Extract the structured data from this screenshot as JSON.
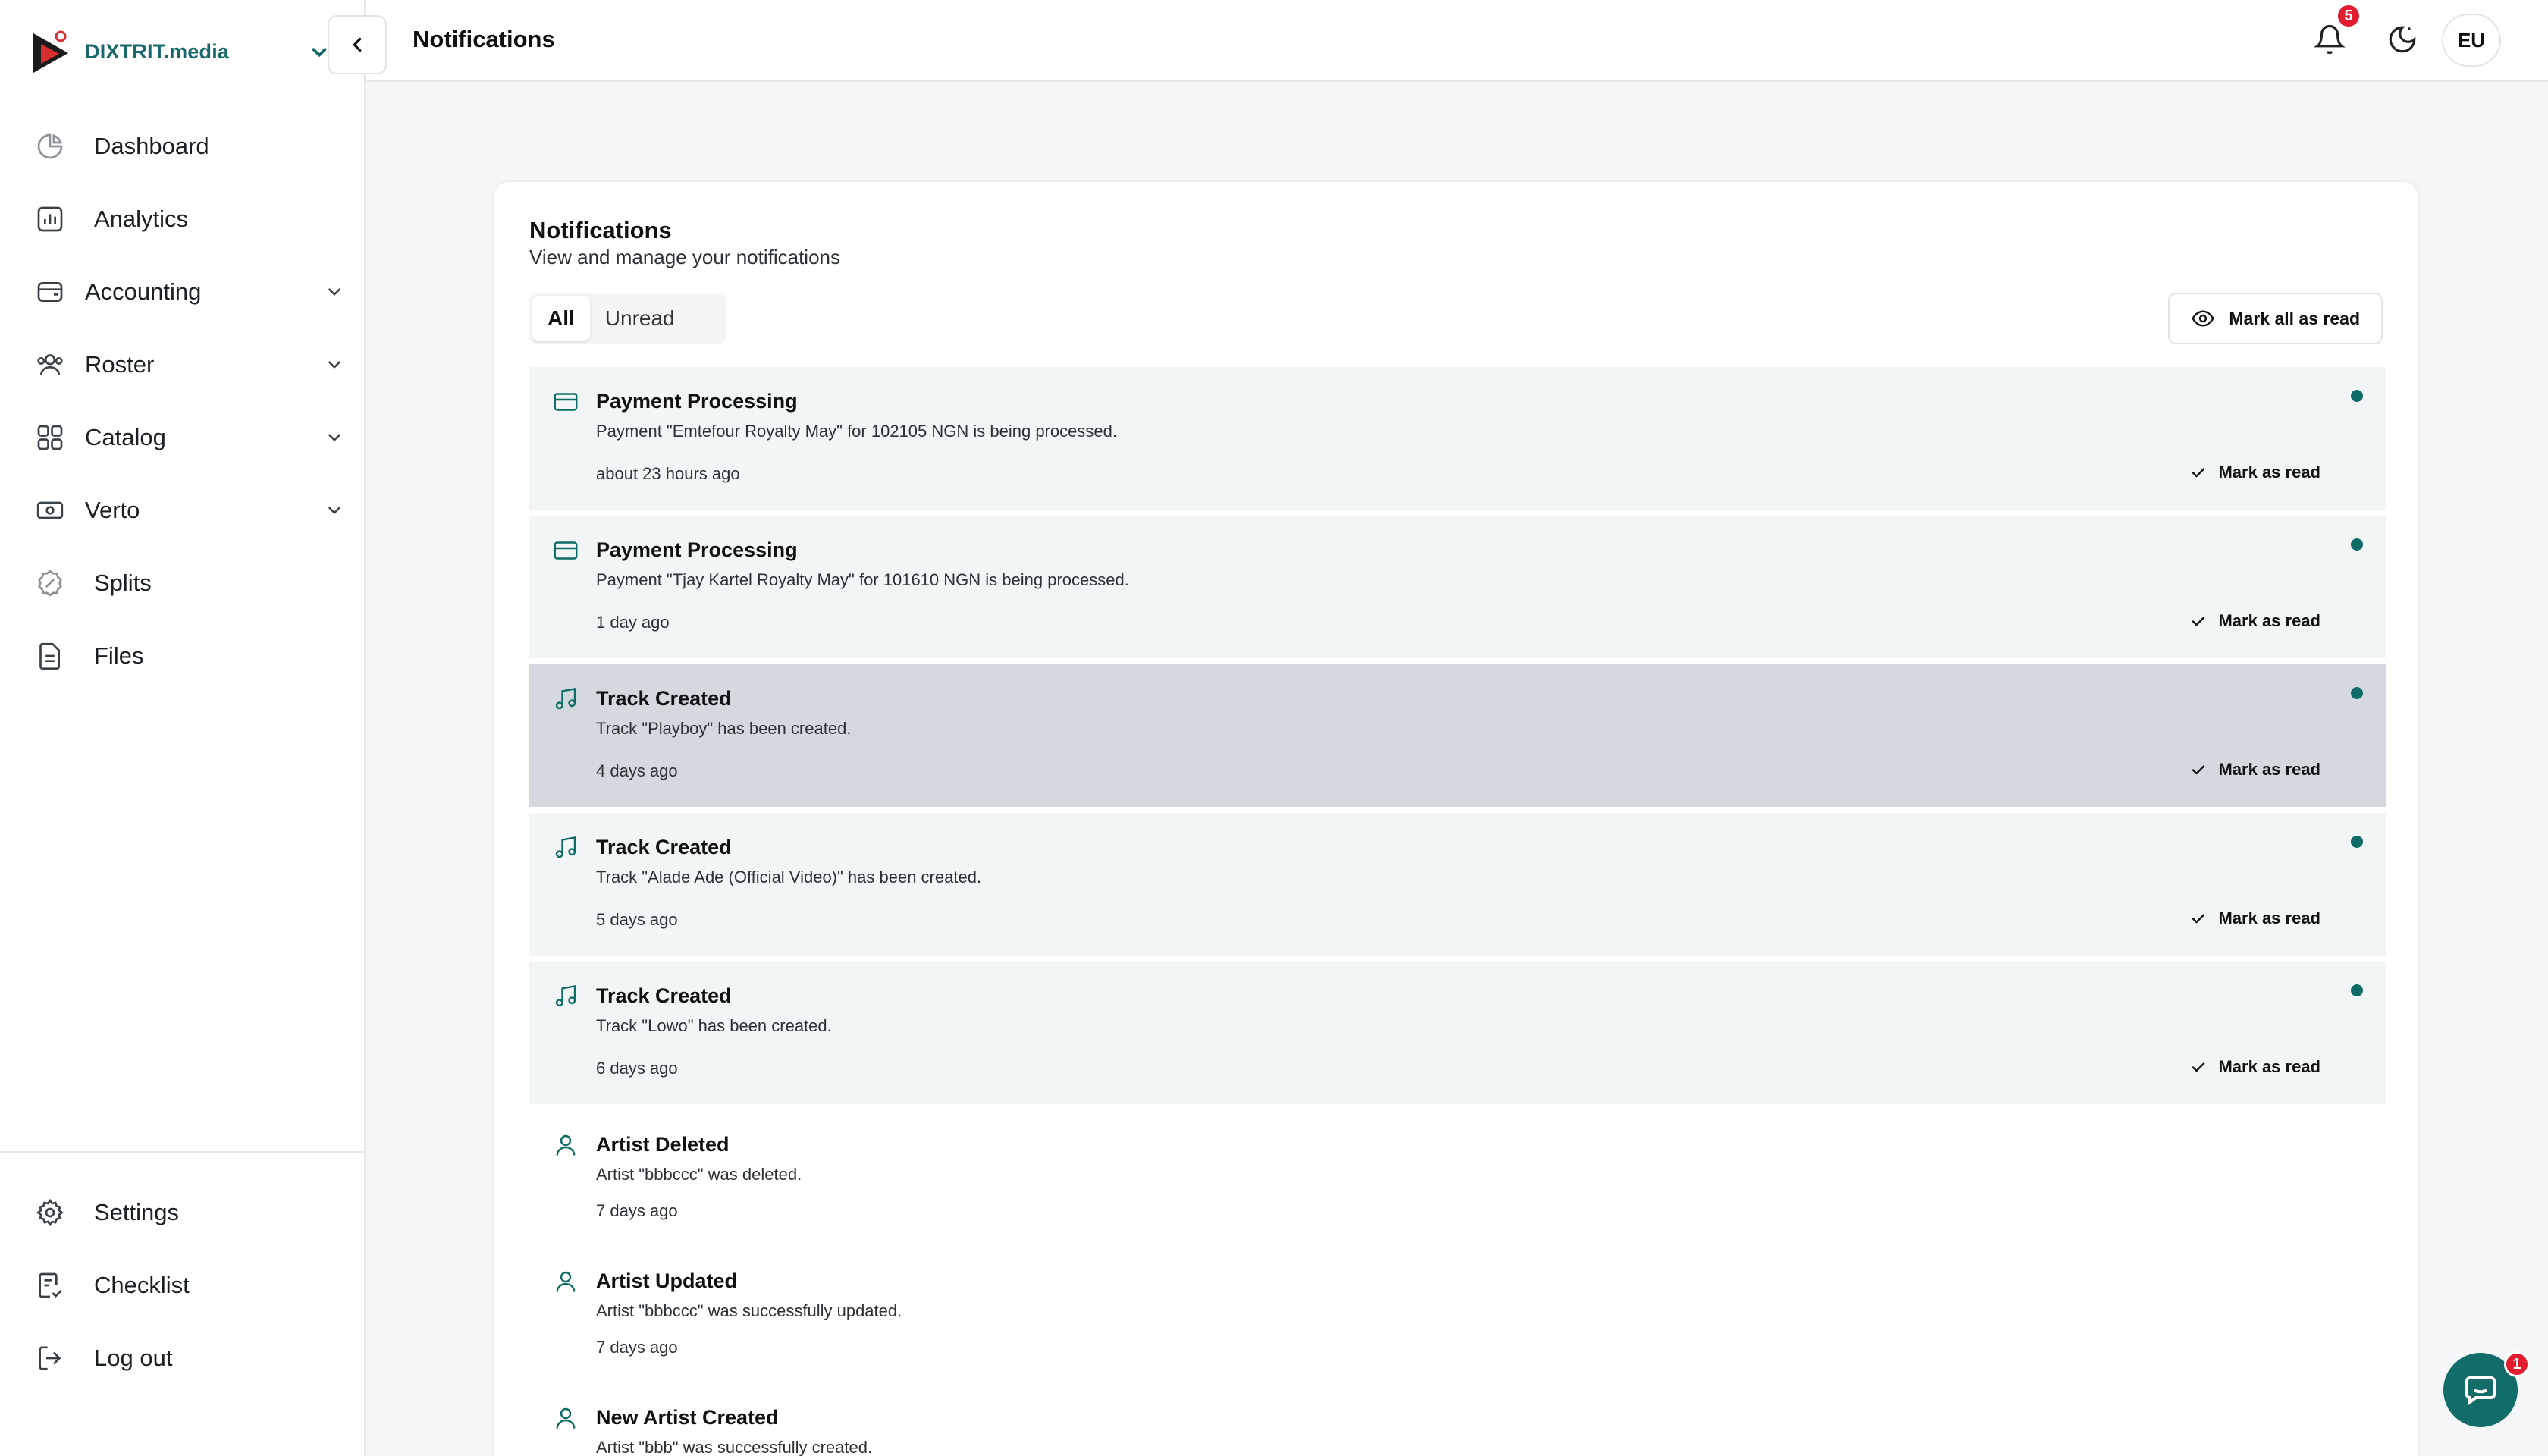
{
  "brand": {
    "name": "DIXTRIT.media"
  },
  "sidebar": {
    "items": [
      {
        "label": "Dashboard",
        "icon": "pie-chart-icon",
        "has_submenu": false
      },
      {
        "label": "Analytics",
        "icon": "bar-chart-icon",
        "has_submenu": false
      },
      {
        "label": "Accounting",
        "icon": "wallet-icon",
        "has_submenu": true
      },
      {
        "label": "Roster",
        "icon": "users-icon",
        "has_submenu": true
      },
      {
        "label": "Catalog",
        "icon": "grid-icon",
        "has_submenu": true
      },
      {
        "label": "Verto",
        "icon": "banknote-icon",
        "has_submenu": true
      },
      {
        "label": "Splits",
        "icon": "badge-percent-icon",
        "has_submenu": false
      },
      {
        "label": "Files",
        "icon": "file-icon",
        "has_submenu": false
      }
    ],
    "bottom_items": [
      {
        "label": "Settings",
        "icon": "gear-icon"
      },
      {
        "label": "Checklist",
        "icon": "clipboard-check-icon"
      },
      {
        "label": "Log out",
        "icon": "logout-icon"
      }
    ]
  },
  "header": {
    "title": "Notifications",
    "notification_count": "5",
    "avatar_initials": "EU"
  },
  "card": {
    "title": "Notifications",
    "subtitle": "View and manage your notifications",
    "tabs": [
      {
        "label": "All",
        "active": true
      },
      {
        "label": "Unread",
        "active": false
      }
    ],
    "mark_all_label": "Mark all as read",
    "mark_label": "Mark as read"
  },
  "notifications": [
    {
      "title": "Payment Processing",
      "body": "Payment \"Emtefour Royalty May\" for 102105 NGN is being processed.",
      "time": "about 23 hours ago",
      "icon": "credit-card-icon",
      "unread": true
    },
    {
      "title": "Payment Processing",
      "body": "Payment \"Tjay Kartel Royalty May\" for 101610 NGN is being processed.",
      "time": "1 day ago",
      "icon": "credit-card-icon",
      "unread": true
    },
    {
      "title": "Track Created",
      "body": "Track \"Playboy\" has been created.",
      "time": "4 days ago",
      "icon": "music-note-icon",
      "unread": true,
      "hovered": true
    },
    {
      "title": "Track Created",
      "body": "Track \"Alade Ade (Official Video)\" has been created.",
      "time": "5 days ago",
      "icon": "music-note-icon",
      "unread": true
    },
    {
      "title": "Track Created",
      "body": "Track \"Lowo\" has been created.",
      "time": "6 days ago",
      "icon": "music-note-icon",
      "unread": true
    },
    {
      "title": "Artist Deleted",
      "body": "Artist \"bbbccc\" was deleted.",
      "time": "7 days ago",
      "icon": "user-icon",
      "unread": false
    },
    {
      "title": "Artist Updated",
      "body": "Artist \"bbbccc\" was successfully updated.",
      "time": "7 days ago",
      "icon": "user-icon",
      "unread": false
    },
    {
      "title": "New Artist Created",
      "body": "Artist \"bbb\" was successfully created.",
      "time": "",
      "icon": "user-icon",
      "unread": false
    }
  ],
  "chat": {
    "badge": "1"
  },
  "colors": {
    "accent": "#0f6b66",
    "brand_text": "#17676b",
    "badge": "#e11d2f",
    "unread_bg": "#f1f5f5",
    "hover_bg": "#d4d9df"
  }
}
